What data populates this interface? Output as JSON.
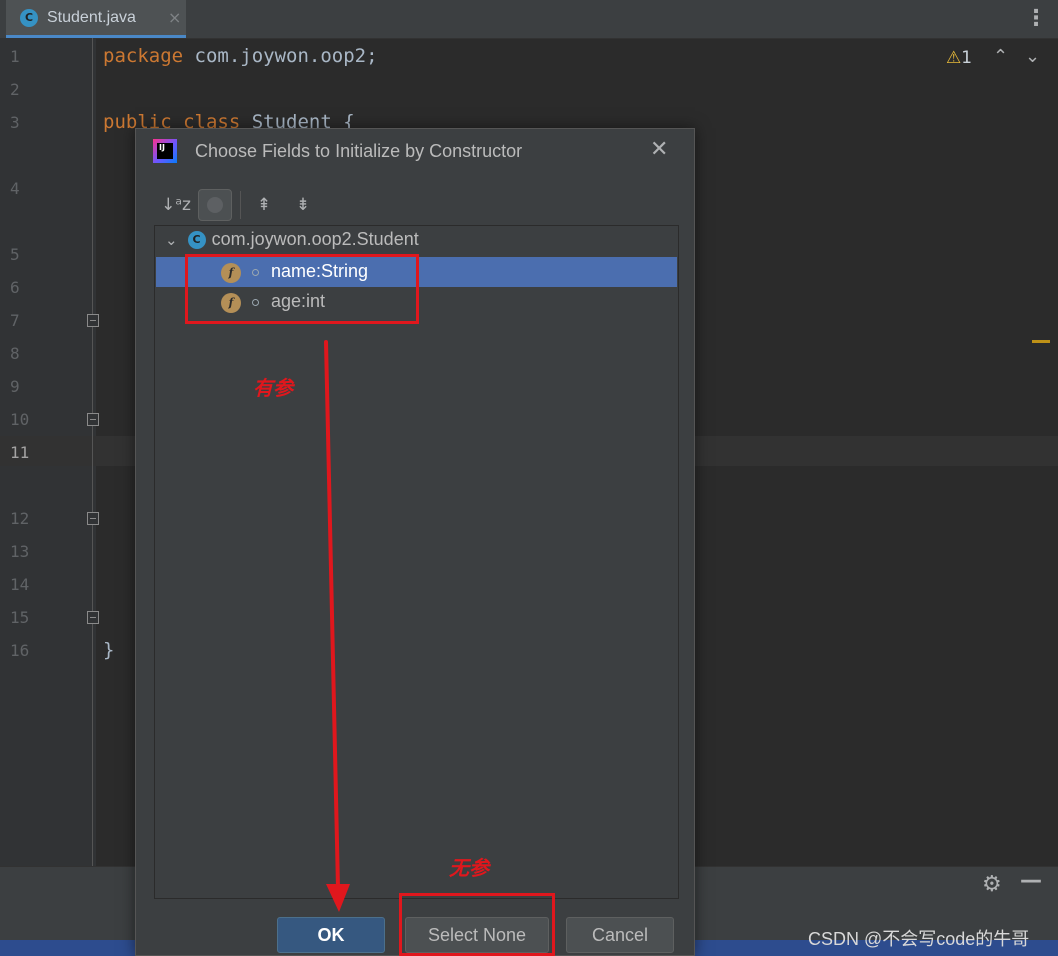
{
  "editor": {
    "tab": {
      "label": "Student.java",
      "icon": "class-c-icon",
      "close": "×"
    },
    "more_menu": "⋮",
    "inspections": {
      "warning_count": "1",
      "up": "⌃",
      "down": "⌄"
    },
    "line_numbers": [
      "1",
      "2",
      "3",
      "4",
      "5",
      "6",
      "7",
      "8",
      "9",
      "10",
      "11",
      "12",
      "13",
      "14",
      "15",
      "16"
    ],
    "current_line": "11",
    "code": {
      "line1_kw": "package",
      "line1_rest": " com.joywon.oop2;",
      "line3_kw1": "public",
      "line3_kw2": "class",
      "line3_rest": " Student {",
      "line16": "}"
    },
    "colors": {
      "keyword": "#cc7832",
      "text": "#a9b7c6",
      "background": "#2b2b2b"
    }
  },
  "dialog": {
    "title": "Choose Fields to Initialize by Constructor",
    "close": "✕",
    "toolbar": {
      "sort": "↓ᵃz",
      "expand_all": "⇞",
      "collapse_all": "⇟"
    },
    "tree": {
      "root": "com.joywon.oop2.Student",
      "root_icon": "C",
      "fields": [
        {
          "label": "name:String",
          "icon": "f",
          "selected": true
        },
        {
          "label": "age:int",
          "icon": "f",
          "selected": false
        }
      ]
    },
    "buttons": {
      "ok": "OK",
      "select_none": "Select None",
      "cancel": "Cancel"
    },
    "colors": {
      "selection": "#4b6eaf",
      "primary_button": "#365880"
    }
  },
  "annotations": {
    "with_params": "有参",
    "no_params": "无参",
    "color": "#e0171d"
  },
  "bottom": {
    "settings_icon": "⚙",
    "minimize": "—"
  },
  "watermark": "CSDN @不会写code的牛哥"
}
